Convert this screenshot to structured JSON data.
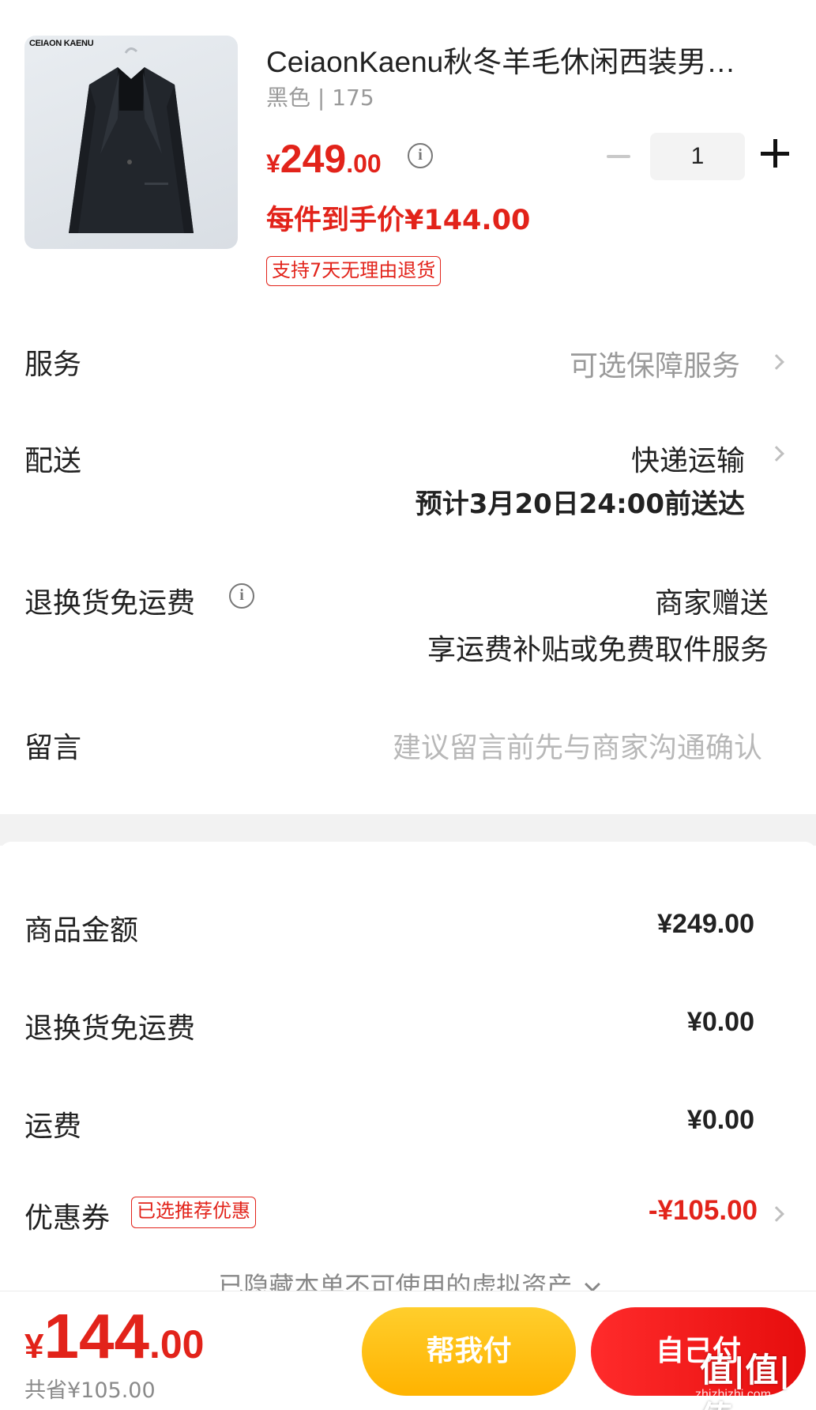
{
  "product": {
    "brand_text": "CEIAON KAENU",
    "title": "CeiaonKaenu秋冬羊毛休闲西装男…",
    "variant": "黑色 | 175",
    "price_symbol": "¥",
    "price_int": "249",
    "price_dec": ".00",
    "quantity": "1",
    "unit_price": "每件到手价¥144.00",
    "return_tag": "支持7天无理由退货"
  },
  "rows": {
    "service_label": "服务",
    "service_value": "可选保障服务",
    "delivery_label": "配送",
    "delivery_method": "快递运输",
    "delivery_eta": "预计3月20日24:00前送达",
    "return_freight_label": "退换货免运费",
    "return_freight_value": "商家赠送",
    "return_freight_desc": "享运费补贴或免费取件服务",
    "message_label": "留言",
    "message_placeholder": "建议留言前先与商家沟通确认"
  },
  "summary": {
    "goods_amount_label": "商品金额",
    "goods_amount_value": "¥249.00",
    "return_freight_label": "退换货免运费",
    "return_freight_value": "¥0.00",
    "shipping_label": "运费",
    "shipping_value": "¥0.00",
    "coupon_label": "优惠券",
    "coupon_tag": "已选推荐优惠",
    "coupon_value": "-¥105.00",
    "hidden_assets": "已隐藏本单不可使用的虚拟资产"
  },
  "footer": {
    "total_symbol": "¥",
    "total_int": "144",
    "total_dec": ".00",
    "saved": "共省¥105.00",
    "help_pay": "帮我付",
    "self_pay": "自己付",
    "watermark": "值|值|值",
    "watermark_url": "zhizhizhi.com"
  },
  "colors": {
    "accent_red": "#e2231a",
    "help_button": "#ffbf14",
    "self_button": "#f21b1b",
    "muted_text": "#9a9a9a"
  }
}
